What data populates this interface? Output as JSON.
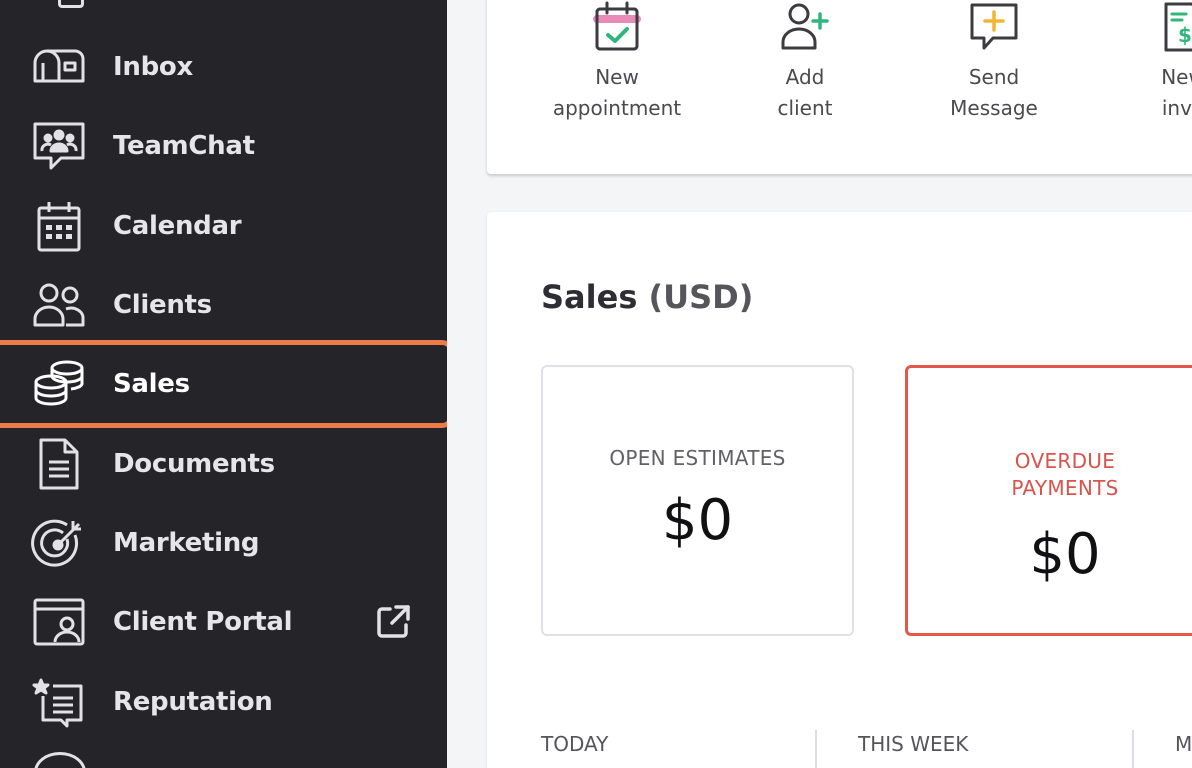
{
  "sidebar": {
    "items": [
      {
        "label": "Inbox",
        "icon": "inbox-icon"
      },
      {
        "label": "TeamChat",
        "icon": "team-chat-icon"
      },
      {
        "label": "Calendar",
        "icon": "calendar-icon"
      },
      {
        "label": "Clients",
        "icon": "clients-icon"
      },
      {
        "label": "Sales",
        "icon": "sales-icon",
        "active": true
      },
      {
        "label": "Documents",
        "icon": "documents-icon"
      },
      {
        "label": "Marketing",
        "icon": "marketing-icon"
      },
      {
        "label": "Client Portal",
        "icon": "client-portal-icon",
        "external": true
      },
      {
        "label": "Reputation",
        "icon": "reputation-icon"
      }
    ]
  },
  "quick_actions": [
    {
      "line1": "New",
      "line2": "appointment",
      "icon": "calendar-check-icon"
    },
    {
      "line1": "Add",
      "line2": "client",
      "icon": "add-user-icon"
    },
    {
      "line1": "Send",
      "line2": "Message",
      "icon": "message-add-icon"
    },
    {
      "line1": "New",
      "line2": "invo",
      "icon": "invoice-icon"
    }
  ],
  "sales": {
    "title": "Sales",
    "unit": "(USD)",
    "open_estimates": {
      "label": "OPEN ESTIMATES",
      "value": "$0"
    },
    "overdue_payments": {
      "label_line1": "OVERDUE",
      "label_line2": "PAYMENTS",
      "value": "$0"
    },
    "periods": [
      "TODAY",
      "THIS WEEK",
      "M"
    ]
  },
  "colors": {
    "sidebar_bg": "#252429",
    "active_outline": "#ee7a46",
    "overdue_red": "#e5574a",
    "accent_green": "#2fb67a",
    "accent_pink": "#e98bb7",
    "accent_yellow": "#f2b531"
  }
}
